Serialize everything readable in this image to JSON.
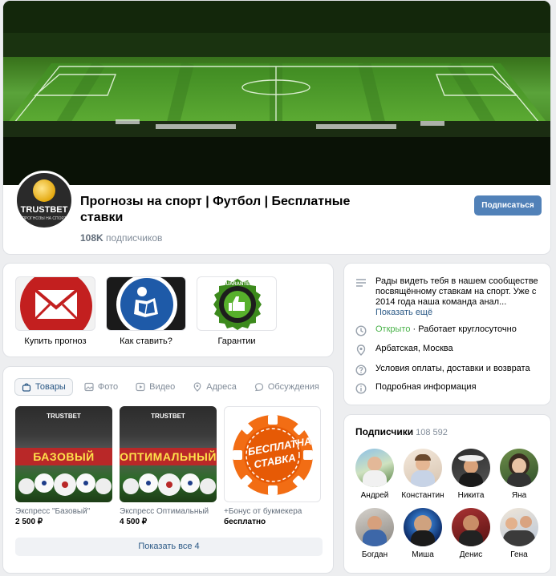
{
  "header": {
    "title": "Прогнозы на спорт | Футбол | Бесплатные ставки",
    "subscribers_count": "108K",
    "subscribers_label": "подписчиков",
    "subscribe_button": "Подписаться",
    "avatar_brand": "TRUSTBET",
    "avatar_sub": "ПРОГНОЗЫ НА СПОРТ"
  },
  "market_links": [
    {
      "label": "Купить прогноз",
      "icon": "envelope-icon"
    },
    {
      "label": "Как ставить?",
      "icon": "reading-person-icon"
    },
    {
      "label": "Гарантии",
      "icon": "guarantee-badge-icon"
    }
  ],
  "guarantee_text": "GUARANTEE",
  "about": {
    "description": "Рады видеть тебя в нашем сообществе посвящённому ставкам на спорт. Уже с 2014 года наша команда анал...",
    "show_more": "Показать ещё",
    "open_status": "Открыто",
    "open_hours": "· Работает круглосуточно",
    "address": "Арбатская, Москва",
    "terms": "Условия оплаты, доставки и возврата",
    "details": "Подробная информация"
  },
  "tabs": [
    {
      "label": "Товары",
      "icon": "bag-icon"
    },
    {
      "label": "Фото",
      "icon": "photo-icon"
    },
    {
      "label": "Видео",
      "icon": "video-icon"
    },
    {
      "label": "Адреса",
      "icon": "pin-icon"
    },
    {
      "label": "Обсуждения",
      "icon": "chat-icon"
    }
  ],
  "products": [
    {
      "name": "Экспресс \"Базовый\"",
      "price": "2 500 ₽",
      "banner": "БАЗОВЫЙ",
      "brand": "TRUSTBET"
    },
    {
      "name": "Экспресс Оптимальный",
      "price": "4 500 ₽",
      "banner": "ОПТИМАЛЬНЫЙ",
      "brand": "TRUSTBET"
    },
    {
      "name": "+Бонус от букмекера",
      "price": "бесплатно",
      "banner": "БЕСПЛАТНАЯ СТАВКА"
    }
  ],
  "show_all": "Показать все 4",
  "subscribers": {
    "title": "Подписчики",
    "count": "108 592",
    "people": [
      {
        "name": "Андрей"
      },
      {
        "name": "Константин"
      },
      {
        "name": "Никита"
      },
      {
        "name": "Яна"
      },
      {
        "name": "Богдан"
      },
      {
        "name": "Миша"
      },
      {
        "name": "Денис"
      },
      {
        "name": "Гена"
      }
    ]
  },
  "colors": {
    "accent": "#5181b8",
    "link": "#2a5885",
    "open_green": "#4bb34b"
  }
}
